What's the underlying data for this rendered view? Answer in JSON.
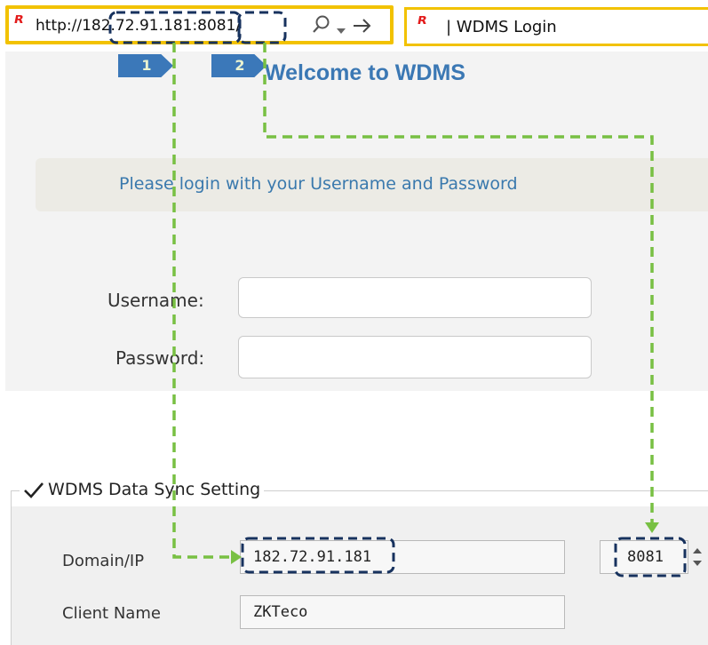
{
  "browser": {
    "address_url": "http://182.72.91.181:8081/",
    "tab_title": "| WDMS Login",
    "logo": "browser-logo-icon"
  },
  "page": {
    "welcome": "Welcome to WDMS",
    "login_prompt": "Please login with your Username and Password",
    "username_label": "Username:",
    "password_label": "Password:"
  },
  "sync": {
    "legend": "WDMS Data Sync Setting",
    "domain_label": "Domain/IP",
    "domain_value": "182.72.91.181",
    "port_value": "8081",
    "client_label": "Client Name",
    "client_value": "ZKTeco"
  },
  "annotations": {
    "badge_1": "1",
    "badge_2": "2",
    "accent": "#3b78b9",
    "arrow_color": "#78c043",
    "highlight_color": "#17325e"
  }
}
